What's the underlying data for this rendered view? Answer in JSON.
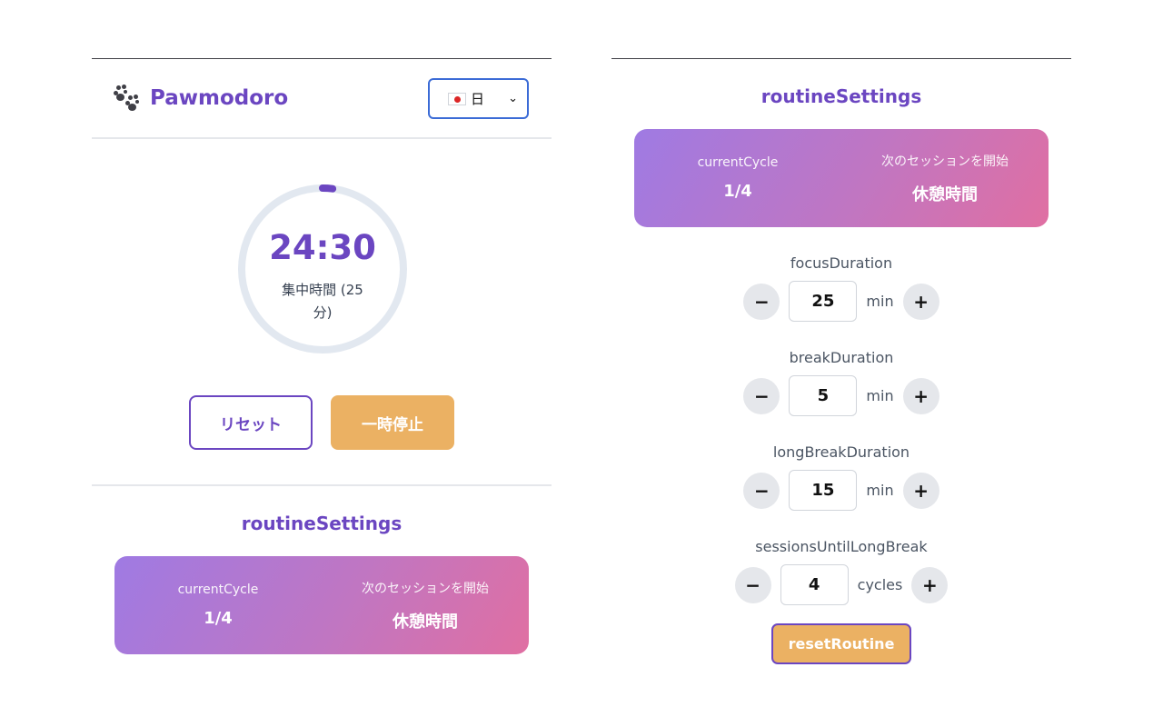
{
  "app": {
    "title": "Pawmodoro",
    "language_label": "日"
  },
  "timer": {
    "time": "24:30",
    "mode_line1": "集中時間 (25",
    "mode_line2": "分)",
    "progress": 0.02,
    "reset_label": "リセット",
    "pause_label": "一時停止"
  },
  "routine": {
    "title": "routineSettings",
    "current_cycle_label": "currentCycle",
    "current_cycle_value": "1/4",
    "next_session_label": "次のセッションを開始",
    "next_session_value": "休憩時間",
    "settings": [
      {
        "label": "focusDuration",
        "value": "25",
        "unit": "min"
      },
      {
        "label": "breakDuration",
        "value": "5",
        "unit": "min"
      },
      {
        "label": "longBreakDuration",
        "value": "15",
        "unit": "min"
      },
      {
        "label": "sessionsUntilLongBreak",
        "value": "4",
        "unit": "cycles"
      }
    ],
    "reset_routine_label": "resetRoutine",
    "minus_symbol": "−",
    "plus_symbol": "+"
  },
  "colors": {
    "accent": "#6b46c1",
    "pause_button": "#ebb163",
    "ring_track": "#e2e8f0",
    "gradient_start": "#9f7ae3",
    "gradient_end": "#e06fa2"
  },
  "icons": {
    "logo": "paw-prints-icon",
    "language_flag": "japan-flag-icon",
    "dropdown": "chevron-down-icon"
  }
}
